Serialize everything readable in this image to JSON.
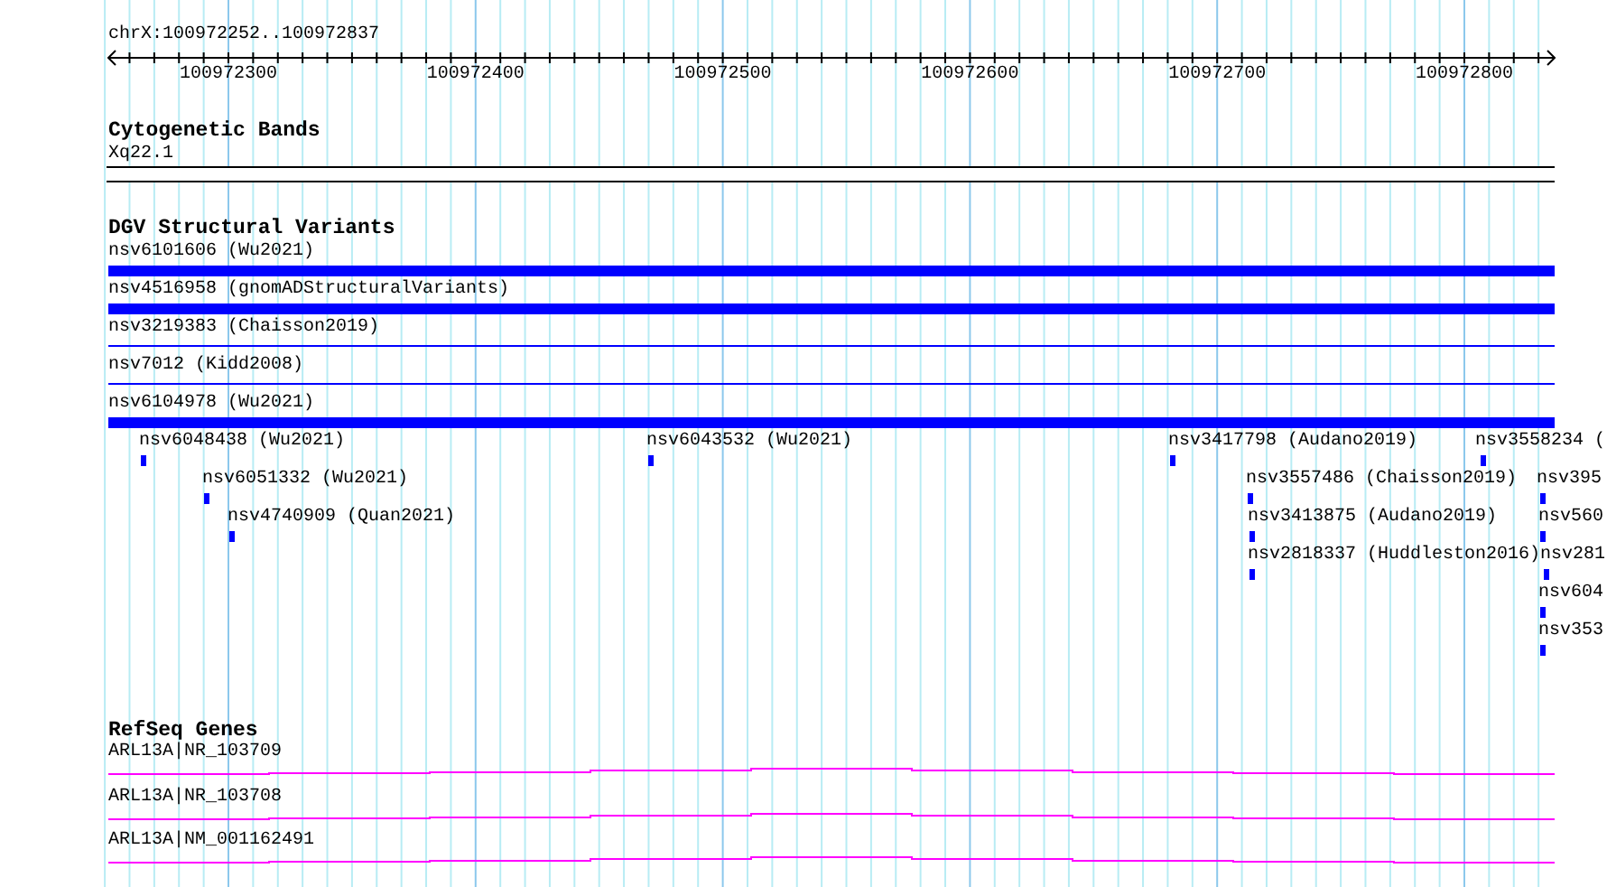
{
  "ruler": {
    "title": "chrX:100972252..100972837",
    "ticks": [
      "100972300",
      "100972400",
      "100972500",
      "100972600",
      "100972700",
      "100972800"
    ]
  },
  "cytoband_track": {
    "title": "Cytogenetic Bands",
    "band": "Xq22.1"
  },
  "dgv_track": {
    "title": "DGV Structural Variants",
    "full_rows": [
      {
        "label": "nsv6101606 (Wu2021)",
        "kind": "thick"
      },
      {
        "label": "nsv4516958 (gnomADStructuralVariants)",
        "kind": "thick"
      },
      {
        "label": "nsv3219383 (Chaisson2019)",
        "kind": "thin"
      },
      {
        "label": "nsv7012 (Kidd2008)",
        "kind": "thin"
      },
      {
        "label": "nsv6104978 (Wu2021)",
        "kind": "thick"
      }
    ],
    "packed_items": [
      {
        "label": "nsv6048438 (Wu2021)"
      },
      {
        "label": "nsv6043532 (Wu2021)"
      },
      {
        "label": "nsv3417798 (Audano2019)"
      },
      {
        "label": "nsv3558234 ("
      },
      {
        "label": "nsv6051332 (Wu2021)"
      },
      {
        "label": "nsv3557486 (Chaisson2019)"
      },
      {
        "label": "nsv395"
      },
      {
        "label": "nsv4740909 (Quan2021)"
      },
      {
        "label": "nsv3413875 (Audano2019)"
      },
      {
        "label": "nsv560"
      },
      {
        "label": "nsv2818337 (Huddleston2016)"
      },
      {
        "label": "nsv281"
      },
      {
        "label": "nsv604"
      },
      {
        "label": "nsv353"
      }
    ]
  },
  "genes_track": {
    "title": "RefSeq Genes",
    "genes": [
      {
        "label": "ARL13A|NR_103709"
      },
      {
        "label": "ARL13A|NR_103708"
      },
      {
        "label": "ARL13A|NM_001162491"
      }
    ]
  }
}
